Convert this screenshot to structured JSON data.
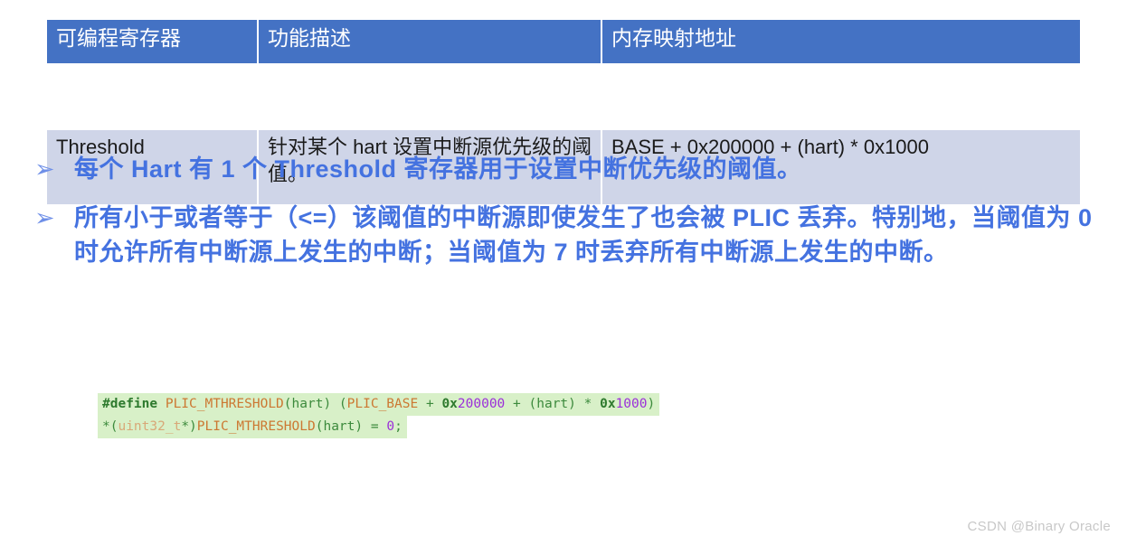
{
  "table": {
    "headers": [
      "可编程寄存器",
      "功能描述",
      "内存映射地址"
    ],
    "rows": [
      {
        "register": "Threshold",
        "description": "针对某个 hart 设置中断源优先级的阈值。",
        "address": "BASE + 0x200000 + (hart) * 0x1000"
      }
    ],
    "header_bg": "#4472C4",
    "row_bg": "#CFD5E8"
  },
  "bullets": [
    {
      "marker": "➢",
      "text": "每个 Hart 有 1 个 Threshold 寄存器用于设置中断优先级的阈值。"
    },
    {
      "marker": "➢",
      "text": "所有小于或者等于（<=）该阈值的中断源即使发生了也会被 PLIC 丢弃。特别地，当阈值为 0 时允许所有中断源上发生的中断；当阈值为 7 时丢弃所有中断源上发生的中断。"
    }
  ],
  "bullet_color": "#4472E0",
  "code": {
    "line1": {
      "keyword": "#define",
      "macro": " PLIC_MTHRESHOLD",
      "open": "(",
      "param": "hart",
      "close_paren": ")",
      "space_paren": " (",
      "base": "PLIC_BASE",
      "plus1": " + ",
      "hex1_prefix": "0x",
      "hex1_digits": "200000",
      "plus2": " + ",
      "paren2_open": "(",
      "param2": "hart",
      "paren2_close": ")",
      "star": " * ",
      "hex2_prefix": "0x",
      "hex2_digits": "1000",
      "end": ")"
    },
    "line2": {
      "deref": "*(",
      "type": "uint32_t",
      "ptr": "*",
      "close": ")",
      "macro": "PLIC_MTHRESHOLD",
      "open": "(",
      "param": "hart",
      "close_paren": ")",
      "assign": " = ",
      "value": "0",
      "semi": ";"
    },
    "bg": "#D8F0C8"
  },
  "watermark": "CSDN @Binary Oracle"
}
